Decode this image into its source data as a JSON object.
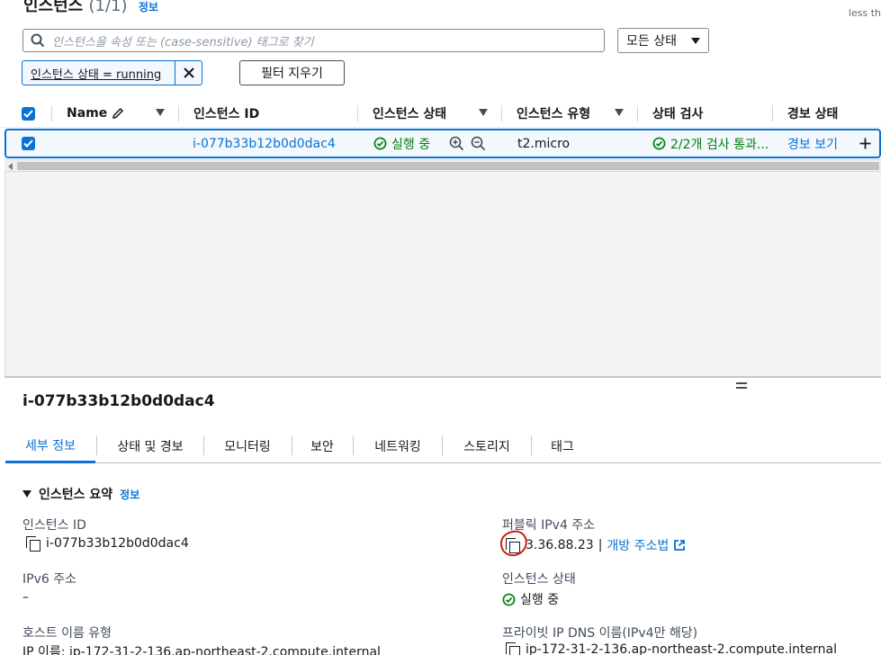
{
  "header": {
    "title": "인스턴스",
    "count": "(1/1)",
    "info": "정보",
    "corner_note": "less th"
  },
  "search": {
    "placeholder": "인스턴스을 속성 또는 (case-sensitive) 태그로 찾기"
  },
  "state_select": {
    "value": "모든 상태"
  },
  "filter_token": {
    "label": "인스턴스 상태 = running"
  },
  "clear_filters": {
    "label": "필터 지우기"
  },
  "table": {
    "columns": [
      "Name",
      "인스턴스 ID",
      "인스턴스 상태",
      "인스턴스 유형",
      "상태 검사",
      "경보 상태"
    ],
    "row": {
      "name": "",
      "instance_id": "i-077b33b12b0d0dac4",
      "state": "실행 중",
      "type": "t2.micro",
      "status_check": "2/2개 검사 통과...",
      "alarm": "경보 보기"
    }
  },
  "detail": {
    "title": "i-077b33b12b0d0dac4",
    "tabs": [
      "세부 정보",
      "상태 및 경보",
      "모니터링",
      "보안",
      "네트워킹",
      "스토리지",
      "태그"
    ],
    "section_title": "인스턴스 요약",
    "section_info": "정보",
    "fields": {
      "instance_id_label": "인스턴스 ID",
      "instance_id_value": "i-077b33b12b0d0dac4",
      "ipv6_label": "IPv6 주소",
      "ipv6_value": "–",
      "hostname_type_label": "호스트 이름 유형",
      "hostname_type_value": "IP 이름: ip-172-31-2-136.ap-northeast-2.compute.internal",
      "public_ipv4_label": "퍼블릭 IPv4 주소",
      "public_ipv4_value": "3.36.88.23",
      "public_ipv4_sep": "|",
      "open_address_link": "개방 주소법",
      "instance_state_label": "인스턴스 상태",
      "instance_state_value": "실행 중",
      "private_dns_label": "프라이빗 IP DNS 이름(IPv4만 해당)",
      "private_dns_value": "ip-172-31-2-136.ap-northeast-2.compute.internal"
    }
  },
  "colors": {
    "accent": "#0972d3",
    "success": "#037f0c",
    "annotation": "#d01c14"
  }
}
